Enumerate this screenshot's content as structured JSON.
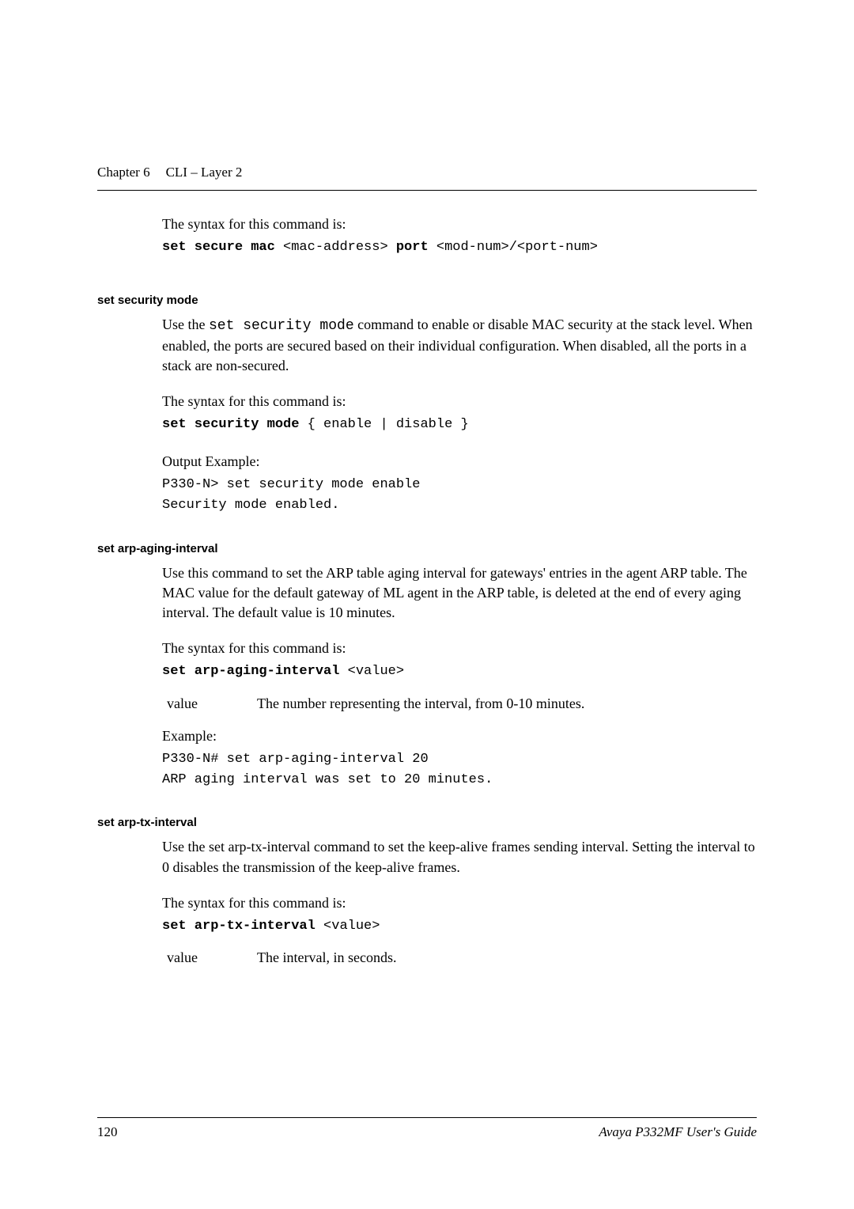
{
  "header": {
    "chapter": "Chapter 6",
    "title": "CLI – Layer 2"
  },
  "intro": {
    "syntax_label": "The syntax for this command is:",
    "code_prefix": "set secure mac ",
    "code_mid1": "<mac-address> ",
    "code_bold_port": "port ",
    "code_suffix": "<mod-num>/<port-num>"
  },
  "security_mode": {
    "heading": "set security mode",
    "desc1": "Use the ",
    "desc_code": "set security mode",
    "desc2": " command to enable or disable MAC security at the stack level. When enabled, the ports are secured based on their individual configuration. When disabled, all the ports in a stack are non-secured.",
    "syntax_label": "The syntax for this command is:",
    "code_bold": "set security mode ",
    "code_rest": "{ enable | disable }",
    "output_label": "Output Example:",
    "output1": "P330-N> set security mode enable",
    "output2": "Security mode enabled."
  },
  "arp_aging": {
    "heading": "set arp-aging-interval",
    "desc": "Use this command to set the ARP table aging interval for gateways' entries in the agent ARP table. The MAC value for the default gateway of ML agent in the ARP table, is deleted at the end of every aging interval. The default value is 10 minutes.",
    "syntax_label": "The syntax for this command is:",
    "code_bold": "set arp-aging-interval ",
    "code_rest": "<value>",
    "param_name": "value",
    "param_desc": "The number representing the interval, from 0-10 minutes.",
    "example_label": "Example:",
    "example1": "P330-N# set arp-aging-interval 20",
    "example2": "ARP aging interval was set to 20 minutes."
  },
  "arp_tx": {
    "heading": "set arp-tx-interval",
    "desc": "Use the set arp-tx-interval command to set the keep-alive frames sending interval. Setting the interval to 0 disables the transmission of the keep-alive frames.",
    "syntax_label": "The syntax for this command is:",
    "code_bold": "set arp-tx-interval ",
    "code_rest": "<value>",
    "param_name": "value",
    "param_desc": "The interval, in seconds."
  },
  "footer": {
    "page_num": "120",
    "guide": "Avaya P332MF User's Guide"
  }
}
